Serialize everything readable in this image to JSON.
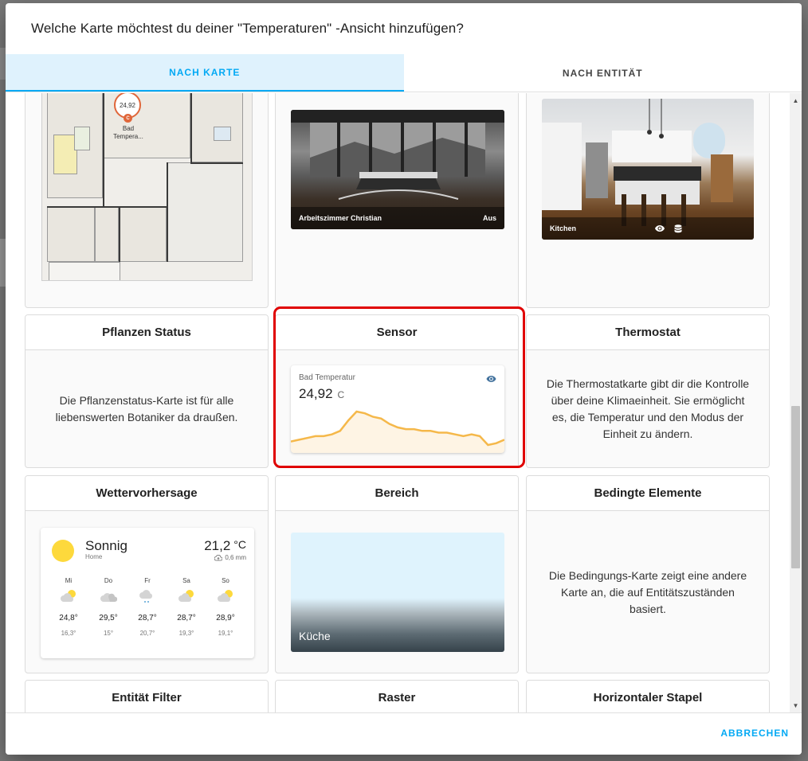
{
  "dialog": {
    "title": "Welche Karte möchtest du deiner \"Temperaturen\" -Ansicht hinzufügen?",
    "cancel_label": "ABBRECHEN"
  },
  "tabs": [
    {
      "label": "NACH KARTE",
      "active": true
    },
    {
      "label": "NACH ENTITÄT",
      "active": false
    }
  ],
  "colors": {
    "accent": "#03a9f4",
    "highlight": "#e00000",
    "sensor_line": "#f5b84a"
  },
  "cards": {
    "picture_elements": {
      "badge_value": "24,92",
      "badge_unit": "C",
      "badge_label_1": "Bad",
      "badge_label_2": "Tempera..."
    },
    "picture_entity": {
      "caption": "Arbeitszimmer Christian",
      "state": "Aus"
    },
    "picture_glance": {
      "caption": "Kitchen",
      "icons": [
        "eye-icon",
        "database-icon"
      ]
    },
    "plant_status": {
      "title": "Pflanzen Status",
      "description": "Die Pflanzenstatus-Karte ist für alle liebenswerten Botaniker da draußen."
    },
    "sensor": {
      "title": "Sensor",
      "name": "Bad Temperatur",
      "value": "24,92",
      "unit": "C",
      "icon": "eye-icon",
      "graph_values": [
        10,
        11,
        12,
        13,
        13,
        14,
        16,
        22,
        27,
        26,
        24,
        23,
        20,
        18,
        17,
        17,
        16,
        16,
        15,
        15,
        14,
        13,
        14,
        13,
        8,
        9,
        11
      ]
    },
    "thermostat": {
      "title": "Thermostat",
      "description": "Die Thermostatkarte gibt dir die Kontrolle über deine Klimaeinheit. Sie ermöglicht es, die Temperatur und den Modus der Einheit zu ändern."
    },
    "weather": {
      "title": "Wettervorhersage",
      "condition": "Sonnig",
      "location": "Home",
      "temperature": "21,2",
      "temp_unit": "°C",
      "precipitation": "0,6 mm",
      "forecast": [
        {
          "day": "Mi",
          "high": "24,8°",
          "low": "16,3°"
        },
        {
          "day": "Do",
          "high": "29,5°",
          "low": "15°"
        },
        {
          "day": "Fr",
          "high": "28,7°",
          "low": "20,7°"
        },
        {
          "day": "Sa",
          "high": "28,7°",
          "low": "19,3°"
        },
        {
          "day": "So",
          "high": "28,9°",
          "low": "19,1°"
        }
      ]
    },
    "area": {
      "title": "Bereich",
      "area_name": "Küche"
    },
    "conditional": {
      "title": "Bedingte Elemente",
      "description": "Die Bedingungs-Karte zeigt eine andere Karte an, die auf Entitätszuständen basiert."
    },
    "entity_filter": {
      "title": "Entität Filter"
    },
    "grid": {
      "title": "Raster"
    },
    "horizontal_stack": {
      "title": "Horizontaler Stapel"
    }
  }
}
